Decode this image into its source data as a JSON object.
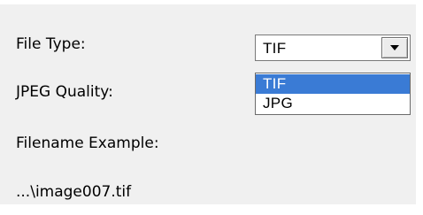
{
  "labels": {
    "file_type": "File Type:",
    "jpeg_quality": "JPEG Quality:",
    "filename_example": "Filename Example:",
    "filename_value": "...\\image007.tif"
  },
  "file_type_select": {
    "value": "TIF",
    "options": [
      "TIF",
      "JPG"
    ],
    "highlighted_option": "TIF",
    "button_icon": "chevron-down-icon"
  },
  "colors": {
    "background": "#f0f0f0",
    "selection_background": "#3a7bd5",
    "selection_text": "#ffffff"
  }
}
